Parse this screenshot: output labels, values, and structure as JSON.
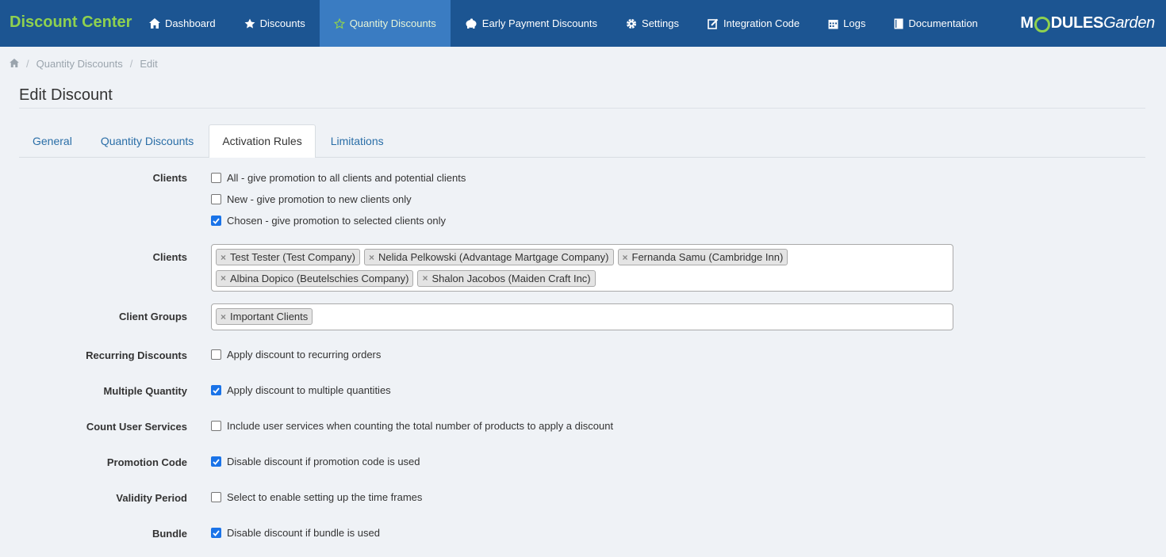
{
  "brand": "Discount Center",
  "nav": {
    "items": [
      {
        "label": "Dashboard",
        "icon": "home-icon"
      },
      {
        "label": "Discounts",
        "icon": "star-icon"
      },
      {
        "label": "Quantity Discounts",
        "icon": "star-outline-icon"
      },
      {
        "label": "Early Payment Discounts",
        "icon": "piggy-bank-icon"
      },
      {
        "label": "Settings",
        "icon": "gear-icon"
      },
      {
        "label": "Integration Code",
        "icon": "edit-icon"
      },
      {
        "label": "Logs",
        "icon": "calendar-icon"
      },
      {
        "label": "Documentation",
        "icon": "book-icon"
      }
    ],
    "logo_part1": "M",
    "logo_part2": "DULES",
    "logo_part3": "Garden"
  },
  "breadcrumb": {
    "items": [
      "Quantity Discounts",
      "Edit"
    ],
    "separator": "/"
  },
  "page_title": "Edit Discount",
  "tabs": [
    "General",
    "Quantity Discounts",
    "Activation Rules",
    "Limitations"
  ],
  "form": {
    "clients_label": "Clients",
    "client_options": [
      {
        "label": "All - give promotion to all clients and potential clients",
        "checked": false
      },
      {
        "label": "New - give promotion to new clients only",
        "checked": false
      },
      {
        "label": "Chosen - give promotion to selected clients only",
        "checked": true
      }
    ],
    "clients_select_label": "Clients",
    "selected_clients": [
      "Test Tester (Test Company)",
      "Nelida Pelkowski (Advantage Martgage Company)",
      "Fernanda Samu (Cambridge Inn)",
      "Albina Dopico (Beutelschies Company)",
      "Shalon Jacobos (Maiden Craft Inc)"
    ],
    "client_groups_label": "Client Groups",
    "selected_groups": [
      "Important Clients"
    ],
    "tag_remove": "×",
    "rows": [
      {
        "label": "Recurring Discounts",
        "text": "Apply discount to recurring orders",
        "checked": false
      },
      {
        "label": "Multiple Quantity",
        "text": "Apply discount to multiple quantities",
        "checked": true
      },
      {
        "label": "Count User Services",
        "text": "Include user services when counting the total number of products to apply a discount",
        "checked": false
      },
      {
        "label": "Promotion Code",
        "text": "Disable discount if promotion code is used",
        "checked": true
      },
      {
        "label": "Validity Period",
        "text": "Select to enable setting up the time frames",
        "checked": false
      },
      {
        "label": "Bundle",
        "text": "Disable discount if bundle is used",
        "checked": true
      }
    ]
  },
  "colors": {
    "nav_bg": "#1c5592",
    "nav_active": "#3a7cc2",
    "brand_green": "#8fd14f",
    "checkbox_on": "#1a73e8"
  }
}
